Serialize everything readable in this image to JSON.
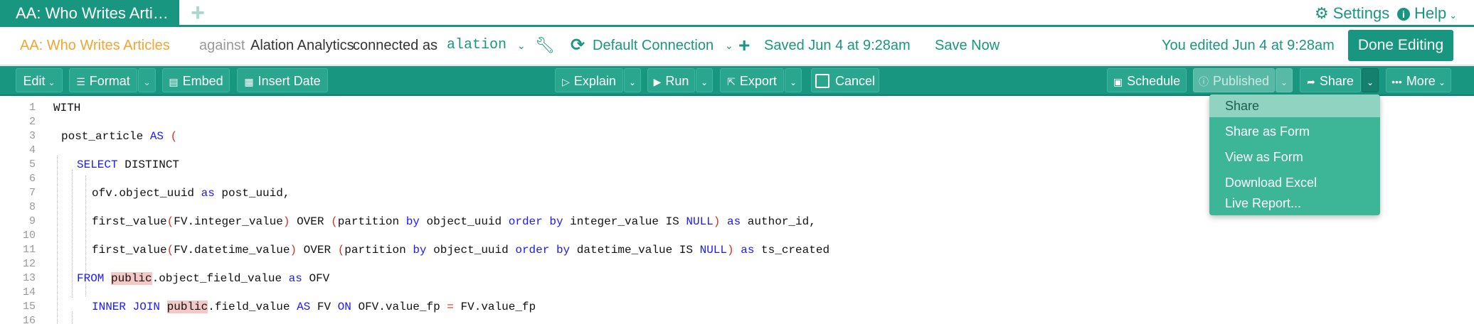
{
  "tabs": [
    {
      "label": "AA: Who Writes Arti…"
    }
  ],
  "header": {
    "add_tab_icon": "plus-icon",
    "settings_label": "Settings",
    "settings_icon": "gear-icon",
    "help_label": "Help",
    "help_icon": "info-circle-icon"
  },
  "infobar": {
    "query_title": "AA: Who Writes Articles",
    "against": "against",
    "datasource": "Alation Analytics",
    "connected_as": "connected as",
    "user": "alation",
    "connection": "Default Connection",
    "saved": "Saved Jun 4 at 9:28am",
    "save_now": "Save Now",
    "edited": "You edited Jun 4 at 9:28am",
    "done_editing": "Done Editing",
    "accent": "#19967f",
    "title_color": "#f0a632"
  },
  "toolbar": {
    "edit": "Edit",
    "format": "Format",
    "embed": "Embed",
    "insert_date": "Insert Date",
    "explain": "Explain",
    "run": "Run",
    "export": "Export",
    "cancel": "Cancel",
    "schedule": "Schedule",
    "published": "Published",
    "share": "Share",
    "more": "More"
  },
  "share_menu": {
    "items": [
      {
        "label": "Share"
      },
      {
        "label": "Share as Form"
      },
      {
        "label": "View as Form"
      },
      {
        "label": "Download Excel"
      },
      {
        "label": "Live Report..."
      }
    ],
    "selected_index": 0
  },
  "editor": {
    "line_numbers": [
      "1",
      "2",
      "3",
      "4",
      "5",
      "6",
      "7",
      "8",
      "9",
      "10",
      "11",
      "12",
      "13",
      "14",
      "15",
      "16"
    ],
    "lines": {
      "l1": {
        "a": "WITH"
      },
      "l3": {
        "a": "post_article ",
        "b": "AS",
        "c": " ("
      },
      "l5": {
        "a": "SELECT",
        "b": " DISTINCT"
      },
      "l7": {
        "a": "ofv.object_uuid ",
        "b": "as",
        "c": " post_uuid,"
      },
      "l9": {
        "a": "first_value",
        "b": "(",
        "c": "FV.integer_value",
        "d": ")",
        "e": " OVER ",
        "f": "(",
        "g": "partition ",
        "h": "by",
        "i": " object_uuid ",
        "j": "order by",
        "k": " integer_value IS ",
        "l": "NULL",
        "m": ")",
        "n": " ",
        "o": "as",
        "p": " author_id,"
      },
      "l11": {
        "a": "first_value",
        "b": "(",
        "c": "FV.datetime_value",
        "d": ")",
        "e": " OVER ",
        "f": "(",
        "g": "partition ",
        "h": "by",
        "i": " object_uuid ",
        "j": "order by",
        "k": " datetime_value IS ",
        "l": "NULL",
        "m": ")",
        "n": " ",
        "o": "as",
        "p": " ts_created"
      },
      "l13": {
        "a": "FROM",
        "b": " ",
        "c": "public",
        "d": ".object_field_value ",
        "e": "as",
        "f": " OFV"
      },
      "l15": {
        "a": "INNER JOIN",
        "b": " ",
        "c": "public",
        "d": ".field_value ",
        "e": "AS",
        "f": " FV ",
        "g": "ON",
        "h": " OFV.value_fp ",
        "i": "=",
        "j": " FV.value_fp"
      }
    }
  }
}
